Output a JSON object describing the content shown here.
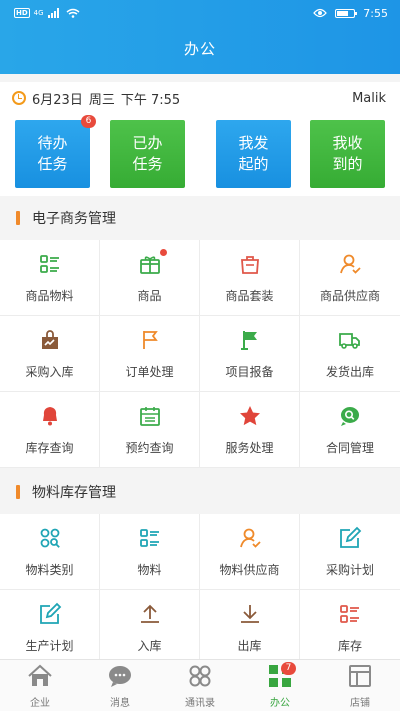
{
  "status": {
    "time": "7:55",
    "network": "HD",
    "signal": "4G"
  },
  "header": {
    "title": "办公"
  },
  "date_row": {
    "date": "6月23日",
    "weekday": "周三",
    "time": "下午 7:55",
    "user": "Malik"
  },
  "tasks": [
    {
      "label": "待办\n任务",
      "badge": "6",
      "color": "blue"
    },
    {
      "label": "已办\n任务",
      "color": "green"
    },
    {
      "label": "我发\n起的",
      "color": "blue"
    },
    {
      "label": "我收\n到的",
      "color": "green"
    }
  ],
  "sections": [
    {
      "title": "电子商务管理",
      "items": [
        {
          "label": "商品物料",
          "icon": "list-icon",
          "color": "#3bab4a"
        },
        {
          "label": "商品",
          "icon": "gift-icon",
          "color": "#3bab4a",
          "dot": true
        },
        {
          "label": "商品套装",
          "icon": "bag-icon",
          "color": "#e0584a"
        },
        {
          "label": "商品供应商",
          "icon": "supplier-icon",
          "color": "#ef8a2b"
        },
        {
          "label": "采购入库",
          "icon": "purchase-icon",
          "color": "#8a5a3a"
        },
        {
          "label": "订单处理",
          "icon": "flag-outline-icon",
          "color": "#ef8a2b"
        },
        {
          "label": "项目报备",
          "icon": "flag-icon",
          "color": "#3bab4a"
        },
        {
          "label": "发货出库",
          "icon": "truck-icon",
          "color": "#3bab4a"
        },
        {
          "label": "库存查询",
          "icon": "bell-icon",
          "color": "#e0453a"
        },
        {
          "label": "预约查询",
          "icon": "calendar-icon",
          "color": "#3bab4a"
        },
        {
          "label": "服务处理",
          "icon": "star-icon",
          "color": "#e0453a"
        },
        {
          "label": "合同管理",
          "icon": "chat-search-icon",
          "color": "#3bab4a"
        }
      ]
    },
    {
      "title": "物料库存管理",
      "items": [
        {
          "label": "物料类别",
          "icon": "category-icon",
          "color": "#1fa5b5"
        },
        {
          "label": "物料",
          "icon": "list-icon",
          "color": "#1fa5b5"
        },
        {
          "label": "物料供应商",
          "icon": "supplier-icon",
          "color": "#ef8a2b"
        },
        {
          "label": "采购计划",
          "icon": "edit-icon",
          "color": "#1fa5b5"
        },
        {
          "label": "生产计划",
          "icon": "edit-icon",
          "color": "#1fa5b5"
        },
        {
          "label": "入库",
          "icon": "upload-icon",
          "color": "#8a5a3a"
        },
        {
          "label": "出库",
          "icon": "download-icon",
          "color": "#8a5a3a"
        },
        {
          "label": "库存",
          "icon": "list-icon",
          "color": "#e0584a"
        }
      ]
    }
  ],
  "tabbar": [
    {
      "label": "企业",
      "icon": "home-icon"
    },
    {
      "label": "消息",
      "icon": "message-icon"
    },
    {
      "label": "通讯录",
      "icon": "contacts-icon"
    },
    {
      "label": "办公",
      "icon": "office-icon",
      "active": true,
      "badge": "7"
    },
    {
      "label": "店铺",
      "icon": "store-icon"
    }
  ]
}
